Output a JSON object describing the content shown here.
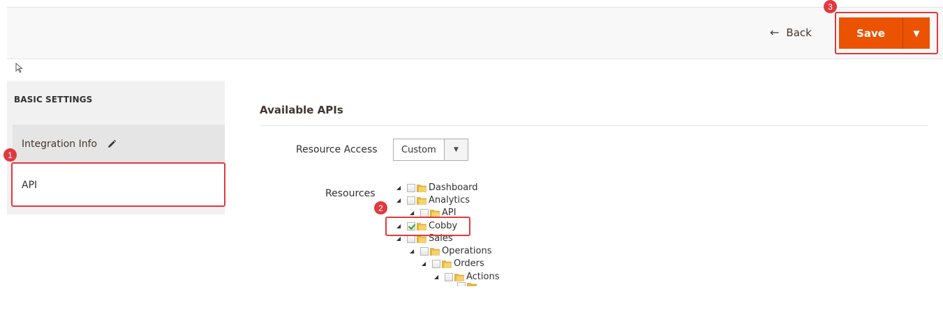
{
  "header": {
    "back_label": "Back",
    "back_icon": "arrow-left-icon",
    "save_label": "Save",
    "save_toggle_icon": "caret-down-icon",
    "accent_color": "#eb5202"
  },
  "sidebar": {
    "title": "BASIC SETTINGS",
    "items": [
      {
        "label": "Integration Info",
        "icon": "pencil-icon"
      },
      {
        "label": "API"
      }
    ]
  },
  "main": {
    "section_title": "Available APIs",
    "resource_access": {
      "label": "Resource Access",
      "value": "Custom"
    },
    "resources": {
      "label": "Resources",
      "tree": [
        {
          "label": "Dashboard",
          "checked": false
        },
        {
          "label": "Analytics",
          "checked": false
        },
        {
          "label": "API",
          "checked": false
        },
        {
          "label": "Cobby",
          "checked": true
        },
        {
          "label": "Sales",
          "checked": false
        },
        {
          "label": "Operations",
          "checked": false
        },
        {
          "label": "Orders",
          "checked": false
        },
        {
          "label": "Actions",
          "checked": false
        }
      ]
    }
  },
  "annotations": {
    "step1": "1",
    "step2": "2",
    "step3": "3",
    "color": "#e0393e"
  }
}
